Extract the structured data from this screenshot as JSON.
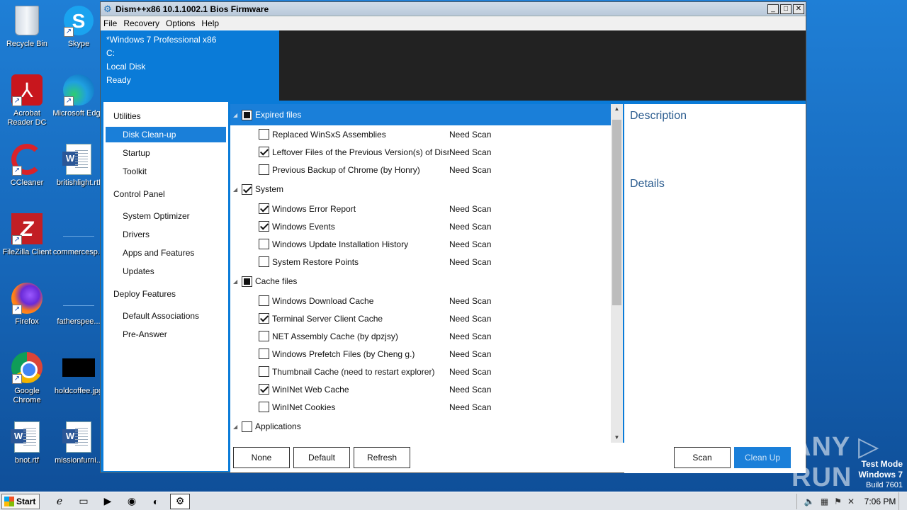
{
  "desktop": {
    "icons": [
      {
        "label": "Recycle Bin"
      },
      {
        "label": "Skype"
      },
      {
        "label": "Acrobat Reader DC"
      },
      {
        "label": "Microsoft Edge"
      },
      {
        "label": "CCleaner"
      },
      {
        "label": "britishlight.rtf"
      },
      {
        "label": "FileZilla Client"
      },
      {
        "label": "commercesp..."
      },
      {
        "label": "Firefox"
      },
      {
        "label": "fatherspee..."
      },
      {
        "label": "Google Chrome"
      },
      {
        "label": "holdcoffee.jpg"
      },
      {
        "label": "bnot.rtf"
      },
      {
        "label": "missionfurni..."
      }
    ]
  },
  "window": {
    "title": "Dism++x86 10.1.1002.1 Bios Firmware",
    "menu": [
      "File",
      "Recovery",
      "Options",
      "Help"
    ],
    "controls": {
      "minimize": "_",
      "maximize": "□",
      "close": "✕"
    }
  },
  "header": {
    "os": "*Windows 7 Professional x86",
    "drive": "C:",
    "disk": "Local Disk",
    "status": "Ready"
  },
  "sidebar": {
    "categories": [
      {
        "label": "Utilities",
        "items": [
          "Disk Clean-up",
          "Startup",
          "Toolkit"
        ]
      },
      {
        "label": "Control Panel",
        "items": [
          "System Optimizer",
          "Drivers",
          "Apps and Features",
          "Updates"
        ]
      },
      {
        "label": "Deploy Features",
        "items": [
          "Default Associations",
          "Pre-Answer"
        ]
      }
    ],
    "active": "Disk Clean-up"
  },
  "cleanup": {
    "groups": [
      {
        "label": "Expired files",
        "state": "partial",
        "items": [
          {
            "name": "Replaced WinSxS Assemblies",
            "status": "Need Scan",
            "checked": false
          },
          {
            "name": "Leftover Files of the Previous Version(s) of Dism++",
            "status": "Need Scan",
            "checked": true
          },
          {
            "name": "Previous Backup of Chrome (by Honry)",
            "status": "Need Scan",
            "checked": false
          }
        ]
      },
      {
        "label": "System",
        "state": "checked",
        "items": [
          {
            "name": "Windows Error Report",
            "status": "Need Scan",
            "checked": true
          },
          {
            "name": "Windows Events",
            "status": "Need Scan",
            "checked": true
          },
          {
            "name": "Windows Update Installation History",
            "status": "Need Scan",
            "checked": false
          },
          {
            "name": "System Restore Points",
            "status": "Need Scan",
            "checked": false
          }
        ]
      },
      {
        "label": "Cache files",
        "state": "partial",
        "items": [
          {
            "name": "Windows Download Cache",
            "status": "Need Scan",
            "checked": false
          },
          {
            "name": "Terminal Server Client Cache",
            "status": "Need Scan",
            "checked": true
          },
          {
            "name": "NET Assembly Cache (by dpzjsy)",
            "status": "Need Scan",
            "checked": false
          },
          {
            "name": "Windows Prefetch Files (by Cheng g.)",
            "status": "Need Scan",
            "checked": false
          },
          {
            "name": "Thumbnail Cache (need to restart explorer)",
            "status": "Need Scan",
            "checked": false
          },
          {
            "name": "WinINet Web Cache",
            "status": "Need Scan",
            "checked": true
          },
          {
            "name": "WinINet Cookies",
            "status": "Need Scan",
            "checked": false
          }
        ]
      },
      {
        "label": "Applications",
        "state": "unchecked",
        "items": []
      }
    ]
  },
  "details_pane": {
    "description_label": "Description",
    "details_label": "Details"
  },
  "buttons": {
    "none": "None",
    "default": "Default",
    "refresh": "Refresh",
    "scan": "Scan",
    "cleanup": "Clean Up"
  },
  "watermark": {
    "text": "ANY ▷ RUN"
  },
  "system_info": {
    "mode": "Test Mode",
    "os": "Windows 7",
    "build": "Build 7601"
  },
  "taskbar": {
    "start": "Start",
    "clock": "7:06 PM"
  }
}
